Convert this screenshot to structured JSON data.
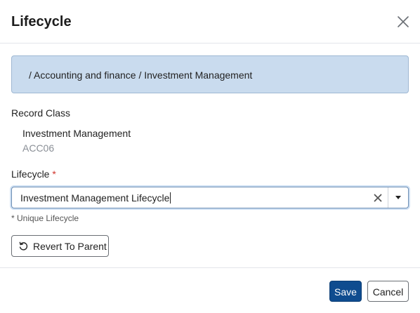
{
  "dialog": {
    "title": "Lifecycle",
    "close_icon": "close-icon"
  },
  "breadcrumb": {
    "path": "/ Accounting and finance / Investment Management"
  },
  "record_class": {
    "label": "Record Class",
    "name": "Investment Management",
    "code": "ACC06"
  },
  "lifecycle": {
    "label": "Lifecycle",
    "required_marker": "*",
    "value": "Investment Management Lifecycle",
    "hint": "* Unique Lifecycle",
    "clear_icon": "clear-icon",
    "dropdown_icon": "caret-down-icon"
  },
  "actions": {
    "revert_label": "Revert To Parent",
    "revert_icon": "undo-icon",
    "save_label": "Save",
    "cancel_label": "Cancel"
  },
  "colors": {
    "primary": "#0f4c8f",
    "breadcrumb_bg": "#c9dbee",
    "required": "#d0342c"
  }
}
